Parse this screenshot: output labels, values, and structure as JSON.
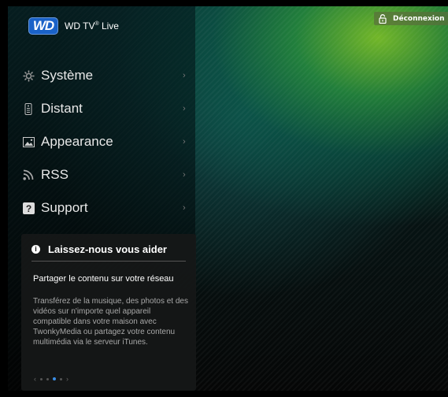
{
  "header": {
    "brand_logo": "WD",
    "product_name": "WD TV",
    "product_reg": "®",
    "product_suffix": "Live",
    "logout_label": "Déconnexion"
  },
  "menu": {
    "items": [
      {
        "label": "Système",
        "icon": "gear-icon"
      },
      {
        "label": "Distant",
        "icon": "remote-icon"
      },
      {
        "label": "Appearance",
        "icon": "picture-icon"
      },
      {
        "label": "RSS",
        "icon": "rss-icon"
      },
      {
        "label": "Support",
        "icon": "help-icon"
      }
    ],
    "chevron": "›"
  },
  "help_panel": {
    "info_glyph": "i",
    "title": "Laissez-nous vous aider",
    "heading": "Partager le contenu sur votre réseau",
    "body": "Transférez de la musique, des photos et des vidéos sur n'importe quel appareil compatible dans votre maison avec TwonkyMedia ou partagez votre contenu multimédia via le serveur iTunes.",
    "prev": "‹",
    "next": "›",
    "pages": 4,
    "active_page": 3
  },
  "colors": {
    "accent_blue": "#1a62c8",
    "active_dot": "#3a8ee6"
  }
}
